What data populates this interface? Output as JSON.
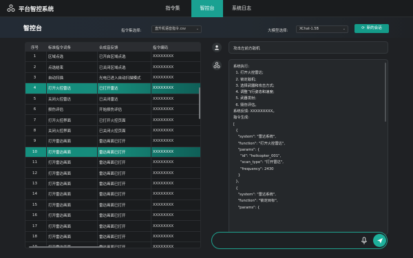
{
  "app": {
    "title": "平台智控系统"
  },
  "nav": {
    "tabs": [
      {
        "label": "指令集"
      },
      {
        "label": "智控台"
      },
      {
        "label": "系统日志"
      }
    ]
  },
  "page": {
    "title": "智控台",
    "set_label": "指令集选择:",
    "set_value": "直升机语音指令.csv",
    "model_label": "大模型选择:",
    "model_value": "XChat-1.5B",
    "new_session": "新的会话"
  },
  "table": {
    "headers": [
      "序号",
      "标准指令词条",
      "合成音反馈",
      "指令编码"
    ],
    "rows": [
      [
        "1",
        "区域点选",
        "已开启区域点选",
        "XXXXXXXX"
      ],
      [
        "2",
        "点选结束",
        "已关闭区域点选",
        "XXXXXXXX"
      ],
      [
        "3",
        "自动扫描",
        "光电已进入自动扫描模式",
        "XXXXXXXX"
      ],
      [
        "4",
        "打开火控雷达",
        "已打开雷达",
        "XXXXXXXX"
      ],
      [
        "5",
        "关闭火控雷达",
        "已关闭雷达",
        "XXXXXXXX"
      ],
      [
        "6",
        "损伤评估",
        "开始损伤评估",
        "XXXXXXXX"
      ],
      [
        "7",
        "打开火控界面",
        "已打开火控页面",
        "XXXXXXXX"
      ],
      [
        "8",
        "关闭火控界面",
        "已关闭火控页面",
        "XXXXXXXX"
      ],
      [
        "9",
        "打开雷达画面",
        "雷达画面已打开",
        "XXXXXXXX"
      ],
      [
        "10",
        "打开雷达画面",
        "雷达画面已打开",
        "XXXXXXXX"
      ],
      [
        "11",
        "打开雷达画面",
        "雷达画面已打开",
        "XXXXXXXX"
      ],
      [
        "12",
        "打开雷达画面",
        "雷达画面已打开",
        "XXXXXXXX"
      ],
      [
        "13",
        "打开雷达画面",
        "雷达画面已打开",
        "XXXXXXXX"
      ],
      [
        "14",
        "打开雷达画面",
        "雷达画面已打开",
        "XXXXXXXX"
      ],
      [
        "15",
        "打开雷达画面",
        "雷达画面已打开",
        "XXXXXXXX"
      ],
      [
        "16",
        "打开雷达画面",
        "雷达画面已打开",
        "XXXXXXXX"
      ],
      [
        "17",
        "打开雷达画面",
        "雷达画面已打开",
        "XXXXXXXX"
      ],
      [
        "18",
        "打开雷达画面",
        "雷达画面已打开",
        "XXXXXXXX"
      ],
      [
        "19",
        "打开雷达画面",
        "雷达画面已打开",
        "XXXXXXXX"
      ]
    ],
    "highlighted_rows": [
      4,
      10
    ]
  },
  "chat": {
    "user_message": "攻击左前方敌机",
    "response_lines": [
      "系统执行:",
      "  1. 打开火控雷达;",
      "  2. 锁定敌机;",
      "  3. 选择武器和攻击方式;",
      "  4. 调整飞行姿态和速度;",
      "  5. 武器发射;",
      "  6. 毁伤评估。",
      "系统反馈: XXXXXXXXX。",
      "指令生成:",
      "[",
      "  {",
      "    \"system\": \"雷达系统\",",
      "    \"function\": \"打开火控雷达\",",
      "    \"params\": {",
      "      \"id\": \"helicopter_001\",",
      "      \"scan_type\": \"打开雷达\",",
      "      \"frequency\": 2430",
      "    }",
      "  },",
      "  {",
      "    \"system\": \"雷达系统\",",
      "    \"function\": \"锁定目标\",",
      "    \"params\": {"
    ],
    "input_placeholder": ""
  },
  "colors": {
    "accent": "#1aa192",
    "background": "#1f2124",
    "panel": "#25282b"
  },
  "icons": [
    "logo-icon",
    "user-icon",
    "assistant-icon",
    "refresh-icon",
    "chevron-down-icon",
    "mic-icon",
    "send-icon"
  ]
}
